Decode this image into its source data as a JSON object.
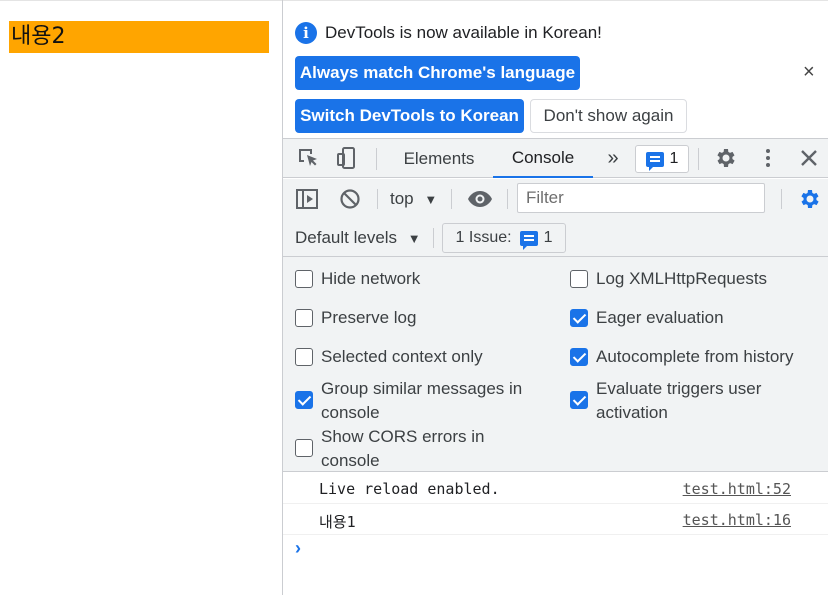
{
  "page": {
    "content_text": "내용2",
    "content_bg": "#ffa500"
  },
  "infobar": {
    "message": "DevTools is now available in Korean!",
    "btn_match": "Always match Chrome's language",
    "btn_switch": "Switch DevTools to Korean",
    "btn_dont_show": "Don't show again",
    "close": "×",
    "info_icon": "i"
  },
  "tabs": {
    "elements": "Elements",
    "console": "Console",
    "more": "»",
    "issues_count": "1"
  },
  "console_toolbar": {
    "context": "top",
    "filter_placeholder": "Filter"
  },
  "levels": {
    "default_levels": "Default levels",
    "issue_label": "1 Issue:",
    "issue_count": "1"
  },
  "settings": {
    "hide_network": "Hide network",
    "preserve_log": "Preserve log",
    "selected_context": "Selected context only",
    "group_similar_1": "Group similar messages in",
    "group_similar_2": "console",
    "show_cors_1": "Show CORS errors in",
    "show_cors_2": "console",
    "log_xhr": "Log XMLHttpRequests",
    "eager_eval": "Eager evaluation",
    "autocomplete": "Autocomplete from history",
    "eval_triggers_1": "Evaluate triggers user",
    "eval_triggers_2": "activation"
  },
  "messages": [
    {
      "text": "Live reload enabled.",
      "source": "test.html:52"
    },
    {
      "text": "내용1",
      "source": "test.html:16"
    }
  ],
  "colors": {
    "accent": "#1a73e8",
    "toolbar_bg": "#f1f3f4"
  }
}
